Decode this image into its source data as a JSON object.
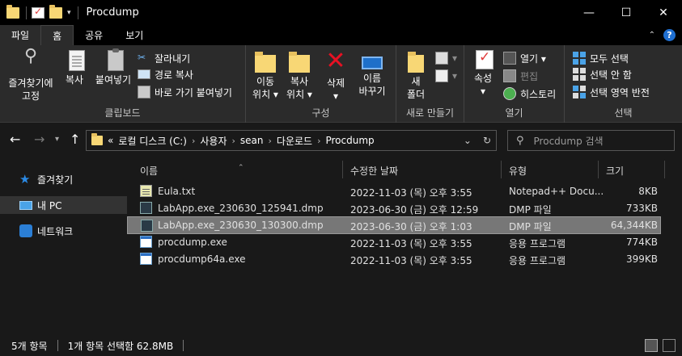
{
  "window": {
    "title": "Procdump",
    "minimize_glyph": "—",
    "maximize_glyph": "☐",
    "close_glyph": "✕"
  },
  "tabs": [
    {
      "label": "파일"
    },
    {
      "label": "홈"
    },
    {
      "label": "공유"
    },
    {
      "label": "보기"
    }
  ],
  "ribbon": {
    "clipboard": {
      "label": "클립보드",
      "pin": "즐겨찾기에\n고정",
      "copy": "복사",
      "paste": "붙여넣기",
      "cut": "잘라내기",
      "copy_path": "경로 복사",
      "paste_shortcut": "바로 가기 붙여넣기"
    },
    "organize": {
      "label": "구성",
      "move_to": "이동\n위치 ▾",
      "copy_to": "복사\n위치 ▾",
      "delete": "삭제\n▾",
      "rename": "이름\n바꾸기"
    },
    "new": {
      "label": "새로 만들기",
      "new_folder": "새\n폴더"
    },
    "open": {
      "label": "열기",
      "properties": "속성\n▾",
      "open": "열기 ▾",
      "edit": "편집",
      "history": "히스토리"
    },
    "select": {
      "label": "선택",
      "select_all": "모두 선택",
      "select_none": "선택 안 함",
      "invert": "선택 영역 반전"
    }
  },
  "address": {
    "prefix": "«",
    "crumbs": [
      "로컬 디스크 (C:)",
      "사용자",
      "sean",
      "다운로드",
      "Procdump"
    ],
    "search_placeholder": "Procdump 검색"
  },
  "nav": {
    "items": [
      {
        "label": "즐겨찾기",
        "icon": "star-icon"
      },
      {
        "label": "내 PC",
        "icon": "pc-icon"
      },
      {
        "label": "네트워크",
        "icon": "network-icon"
      }
    ]
  },
  "columns": {
    "name": "이름",
    "date": "수정한 날짜",
    "type": "유형",
    "size": "크기"
  },
  "files": [
    {
      "name": "Eula.txt",
      "date": "2022-11-03 (목) 오후 3:55",
      "type": "Notepad++ Docu...",
      "size": "8KB",
      "icon": "text-file-icon"
    },
    {
      "name": "LabApp.exe_230630_125941.dmp",
      "date": "2023-06-30 (금) 오후 12:59",
      "type": "DMP 파일",
      "size": "733KB",
      "icon": "dump-file-icon"
    },
    {
      "name": "LabApp.exe_230630_130300.dmp",
      "date": "2023-06-30 (금) 오후 1:03",
      "type": "DMP 파일",
      "size": "64,344KB",
      "icon": "dump-file-icon",
      "selected": true
    },
    {
      "name": "procdump.exe",
      "date": "2022-11-03 (목) 오후 3:55",
      "type": "응용 프로그램",
      "size": "774KB",
      "icon": "exe-file-icon"
    },
    {
      "name": "procdump64a.exe",
      "date": "2022-11-03 (목) 오후 3:55",
      "type": "응용 프로그램",
      "size": "399KB",
      "icon": "exe-file-icon"
    }
  ],
  "status": {
    "count": "5개 항목",
    "selection": "1개 항목 선택함 62.8MB"
  }
}
